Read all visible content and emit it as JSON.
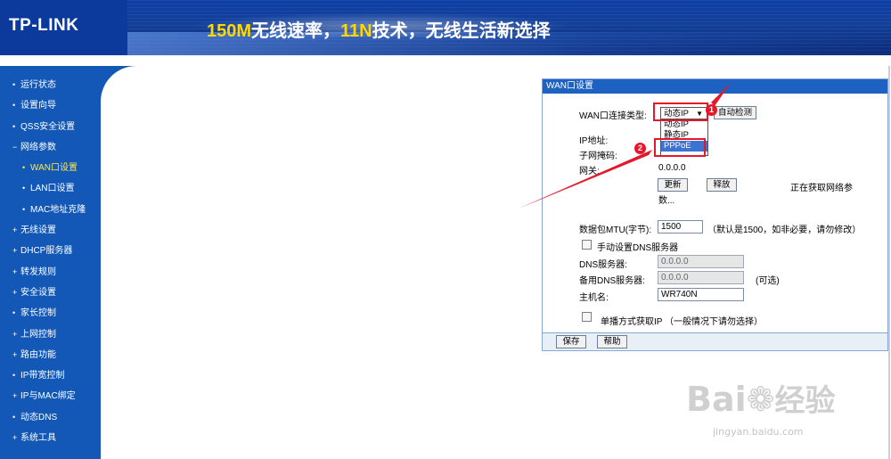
{
  "header": {
    "logo": "TP-LINK",
    "slogan_parts": [
      "150M",
      "无线速率，",
      "11N",
      "技术，无线生活新选择"
    ]
  },
  "sidebar": {
    "items": [
      {
        "label": "运行状态",
        "bullet": "•"
      },
      {
        "label": "设置向导",
        "bullet": "•"
      },
      {
        "label": "QSS安全设置",
        "bullet": "•"
      },
      {
        "label": "网络参数",
        "bullet": "−"
      },
      {
        "label": "WAN口设置",
        "bullet": "•"
      },
      {
        "label": "LAN口设置",
        "bullet": "•"
      },
      {
        "label": "MAC地址克隆",
        "bullet": "•"
      },
      {
        "label": "无线设置",
        "bullet": "+"
      },
      {
        "label": "DHCP服务器",
        "bullet": "+"
      },
      {
        "label": "转发规则",
        "bullet": "+"
      },
      {
        "label": "安全设置",
        "bullet": "+"
      },
      {
        "label": "家长控制",
        "bullet": "•"
      },
      {
        "label": "上网控制",
        "bullet": "+"
      },
      {
        "label": "路由功能",
        "bullet": "+"
      },
      {
        "label": "IP带宽控制",
        "bullet": "•"
      },
      {
        "label": "IP与MAC绑定",
        "bullet": "+"
      },
      {
        "label": "动态DNS",
        "bullet": "•"
      },
      {
        "label": "系统工具",
        "bullet": "+"
      }
    ]
  },
  "panel": {
    "title": "WAN口设置",
    "wan_type_label": "WAN口连接类型:",
    "wan_type_value": "动态IP",
    "wan_type_options": [
      "动态IP",
      "静态IP",
      "PPPoE"
    ],
    "auto_detect_button": "自动检测",
    "ip_label": "IP地址:",
    "mask_label": "子网掩码:",
    "gateway_label": "网关:",
    "gateway_value": "0.0.0.0",
    "renew_button": "更新",
    "release_button": "释放",
    "status_text_1": "正在获取网络参",
    "status_text_2": "数...",
    "mtu_label": "数据包MTU(字节):",
    "mtu_value": "1500",
    "mtu_hint": "（默认是1500，如非必要，请勿修改）",
    "manual_dns_label": "手动设置DNS服务器",
    "dns_label": "DNS服务器:",
    "dns_value": "0.0.0.0",
    "dns2_label": "备用DNS服务器:",
    "dns2_value": "0.0.0.0",
    "dns2_hint": "(可选)",
    "hostname_label": "主机名:",
    "hostname_value": "WR740N",
    "unicast_label": "单播方式获取IP （一般情况下请勿选择）",
    "save_button": "保存",
    "help_button": "帮助"
  },
  "annotations": {
    "badge1": "1",
    "badge2": "2",
    "color": "#e5182b"
  },
  "watermark": {
    "brand": "Bai",
    "brand2": "经验",
    "url": "jingyan.baidu.com"
  }
}
